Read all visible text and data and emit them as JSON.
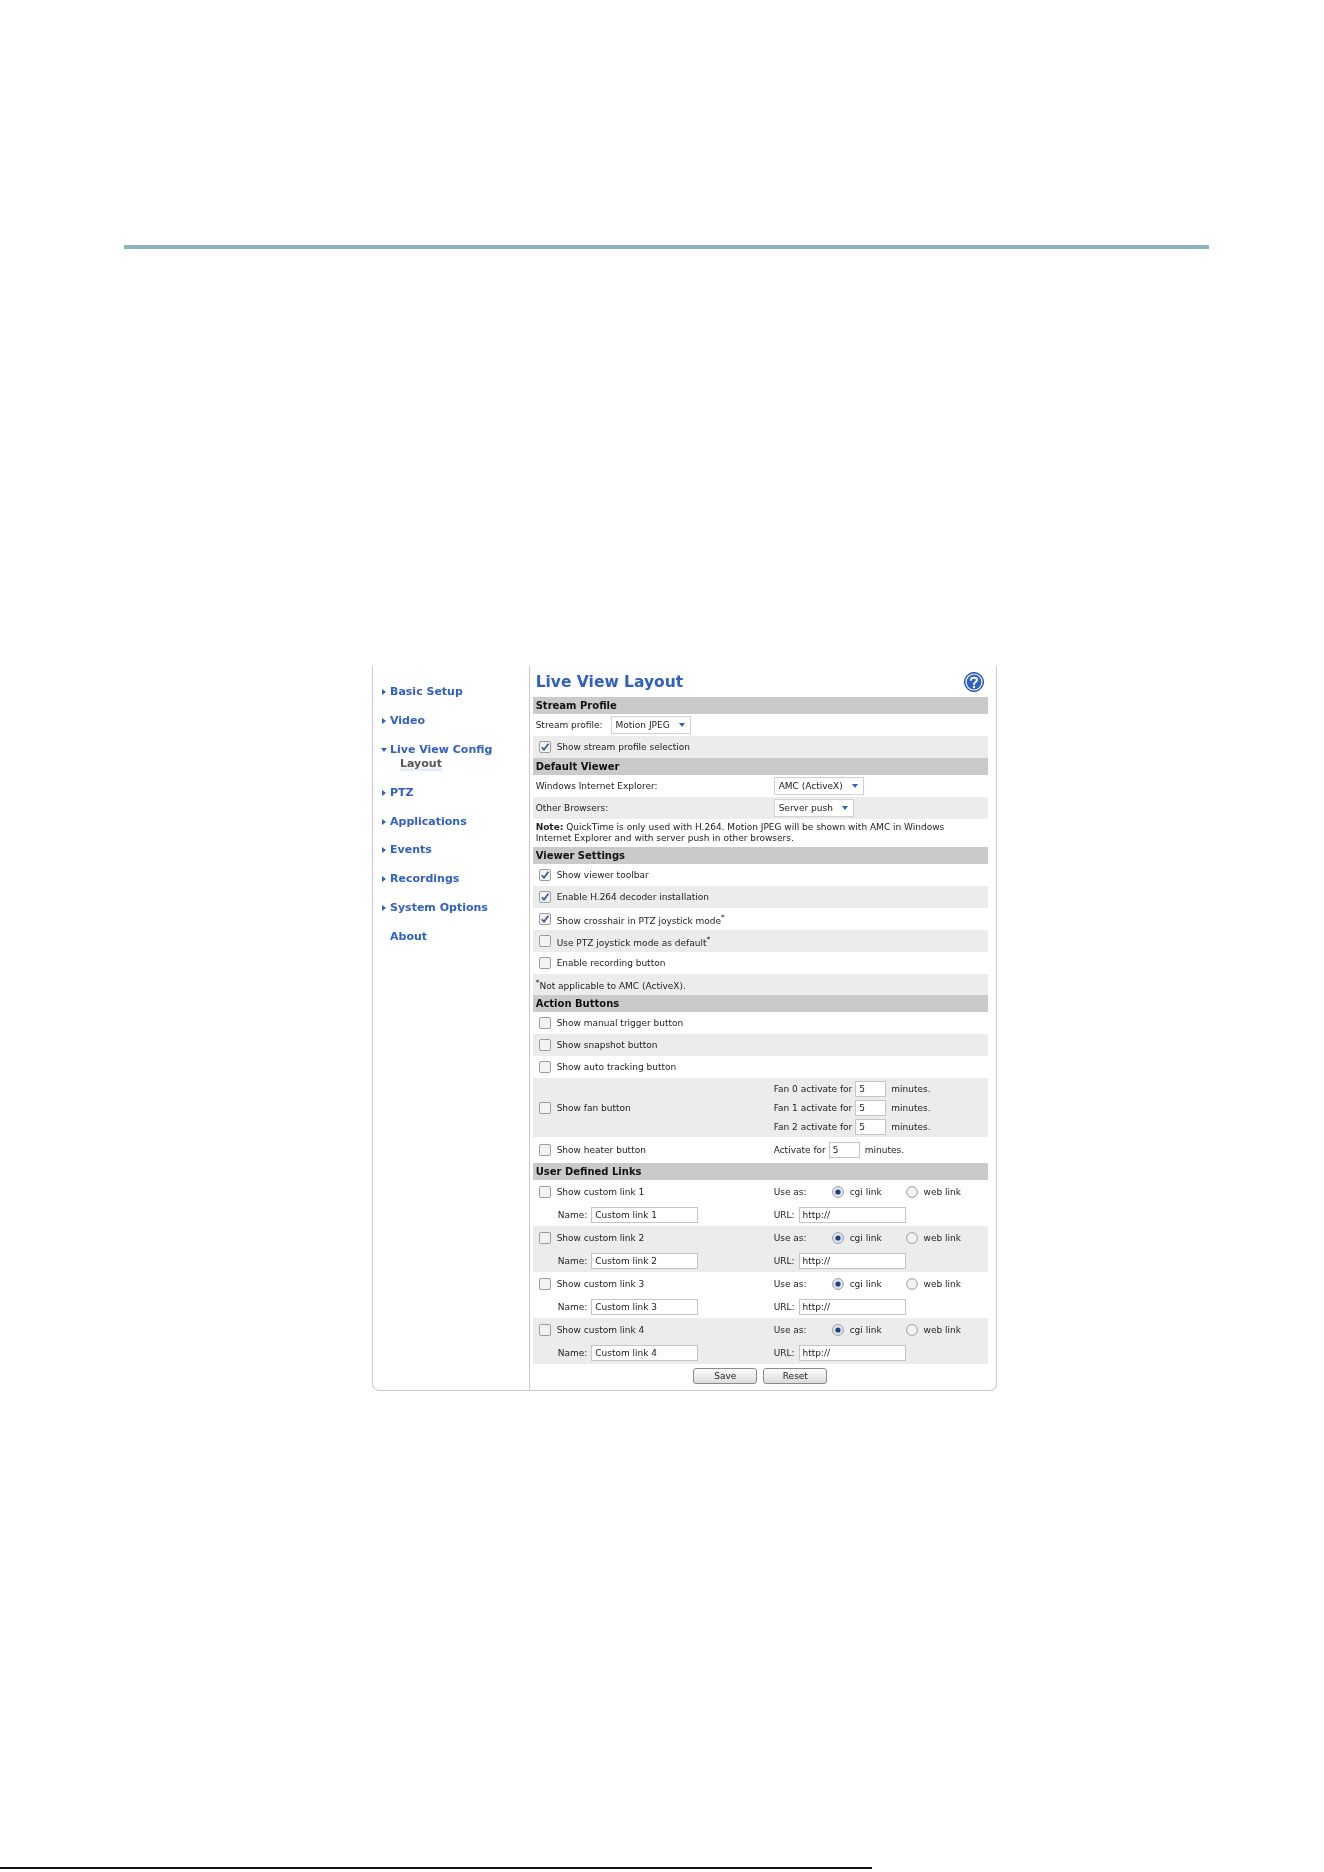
{
  "sidebar": {
    "items": [
      {
        "label": "Basic Setup",
        "kind": "group",
        "expanded": false
      },
      {
        "label": "Video",
        "kind": "group",
        "expanded": false
      },
      {
        "label": "Live View Config",
        "kind": "group",
        "expanded": true,
        "children": [
          {
            "label": "Layout",
            "selected": true
          }
        ]
      },
      {
        "label": "PTZ",
        "kind": "group",
        "expanded": false
      },
      {
        "label": "Applications",
        "kind": "group",
        "expanded": false
      },
      {
        "label": "Events",
        "kind": "group",
        "expanded": false
      },
      {
        "label": "Recordings",
        "kind": "group",
        "expanded": false
      },
      {
        "label": "System Options",
        "kind": "group",
        "expanded": false
      },
      {
        "label": "About",
        "kind": "link"
      }
    ]
  },
  "main": {
    "title": "Live View Layout",
    "sections": [
      {
        "title": "Stream Profile",
        "rows": [
          {
            "kind": "select_inline",
            "label": "Stream profile:",
            "value": "Motion JPEG"
          },
          {
            "kind": "checkbox",
            "label": "Show stream profile selection",
            "checked": true
          }
        ]
      },
      {
        "title": "Default Viewer",
        "rows": [
          {
            "kind": "select",
            "label": "Windows Internet Explorer:",
            "value": "AMC (ActiveX)"
          },
          {
            "kind": "select",
            "label": "Other Browsers:",
            "value": "Server push"
          },
          {
            "kind": "note",
            "text": "**Note:** QuickTime is only used with H.264. Motion JPEG will be shown with AMC in Windows Internet Explorer and with server push in other browsers."
          }
        ]
      },
      {
        "title": "Viewer Settings",
        "rows": [
          {
            "kind": "checkbox",
            "label": "Show viewer toolbar",
            "checked": true
          },
          {
            "kind": "checkbox",
            "label": "Enable H.264 decoder installation",
            "checked": true
          },
          {
            "kind": "checkbox",
            "label": "Show crosshair in PTZ joystick mode$^{*}$",
            "checked": true
          },
          {
            "kind": "checkbox",
            "label": "Use PTZ joystick mode as default$^{*}$",
            "checked": false
          },
          {
            "kind": "checkbox",
            "label": "Enable recording button",
            "checked": false
          },
          {
            "kind": "note",
            "text": "$^{*}$Not applicable to AMC (ActiveX)."
          }
        ]
      },
      {
        "title": "Action Buttons",
        "rows": [
          {
            "kind": "checkbox",
            "label": "Show manual trigger button",
            "checked": false
          },
          {
            "kind": "checkbox",
            "label": "Show snapshot button",
            "checked": false
          },
          {
            "kind": "checkbox",
            "label": "Show auto tracking button",
            "checked": false
          },
          {
            "kind": "timers",
            "label": "Show fan button",
            "checked": false,
            "timers": [
              {
                "label": "Fan 0 activate for",
                "value": "5",
                "unit": "minutes."
              },
              {
                "label": "Fan 1 activate for",
                "value": "5",
                "unit": "minutes."
              },
              {
                "label": "Fan 2 activate for",
                "value": "5",
                "unit": "minutes."
              }
            ]
          },
          {
            "kind": "timers",
            "label": "Show heater button",
            "checked": false,
            "timers": [
              {
                "label": "Activate for",
                "value": "5",
                "unit": "minutes."
              }
            ]
          }
        ]
      },
      {
        "title": "User Defined Links",
        "rows": [
          {
            "kind": "link",
            "label": "Show custom link 1",
            "checked": false,
            "use_as_label": "Use as:",
            "options": [
              {
                "label": "cgi link",
                "selected": true
              },
              {
                "label": "web link",
                "selected": false
              }
            ],
            "name_label": "Name:",
            "name_value": "Custom link 1",
            "url_label": "URL:",
            "url_value": "http://"
          },
          {
            "kind": "link",
            "label": "Show custom link 2",
            "checked": false,
            "use_as_label": "Use as:",
            "options": [
              {
                "label": "cgi link",
                "selected": true
              },
              {
                "label": "web link",
                "selected": false
              }
            ],
            "name_label": "Name:",
            "name_value": "Custom link 2",
            "url_label": "URL:",
            "url_value": "http://"
          },
          {
            "kind": "link",
            "label": "Show custom link 3",
            "checked": false,
            "use_as_label": "Use as:",
            "options": [
              {
                "label": "cgi link",
                "selected": true
              },
              {
                "label": "web link",
                "selected": false
              }
            ],
            "name_label": "Name:",
            "name_value": "Custom link 3",
            "url_label": "URL:",
            "url_value": "http://"
          },
          {
            "kind": "link",
            "label": "Show custom link 4",
            "checked": false,
            "use_as_label": "Use as:",
            "options": [
              {
                "label": "cgi link",
                "selected": true
              },
              {
                "label": "web link",
                "selected": false
              }
            ],
            "name_label": "Name:",
            "name_value": "Custom link 4",
            "url_label": "URL:",
            "url_value": "http://"
          }
        ]
      }
    ],
    "buttons": [
      "Save",
      "Reset"
    ]
  }
}
